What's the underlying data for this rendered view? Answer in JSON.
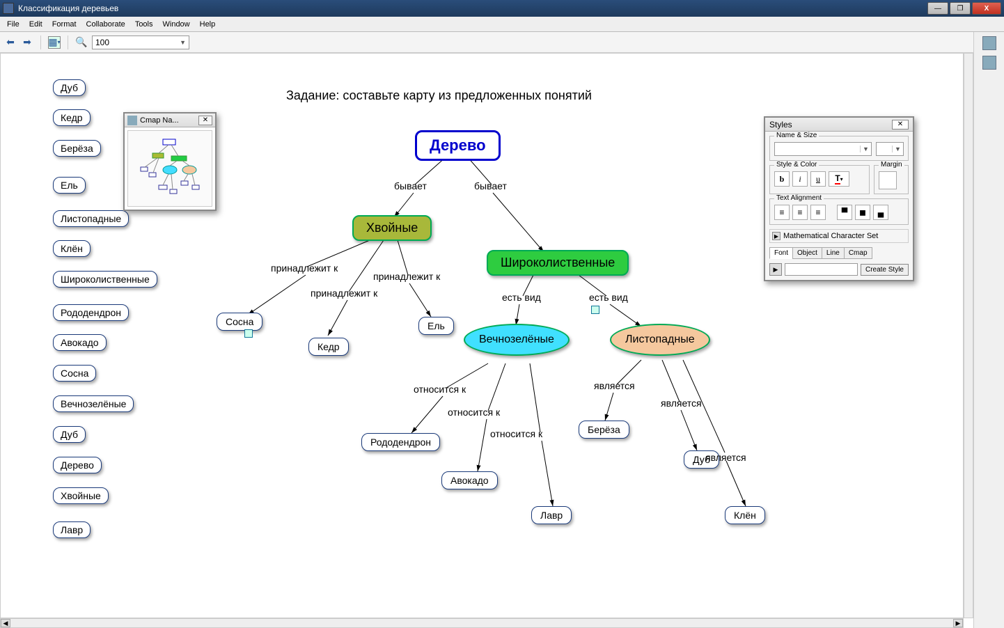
{
  "window": {
    "title": "Классификация деревьев"
  },
  "menu": {
    "file": "File",
    "edit": "Edit",
    "format": "Format",
    "collaborate": "Collaborate",
    "tools": "Tools",
    "window": "Window",
    "help": "Help"
  },
  "toolbar": {
    "zoom": "100"
  },
  "task": "Задание: составьте карту из предложенных понятий",
  "palette": [
    "Дуб",
    "Кедр",
    "Берёза",
    "Ель",
    "Листопадные",
    "Клён",
    "Широколиственные",
    "Рододендрон",
    "Авокадо",
    "Сосна",
    "Вечнозелёные",
    "Дуб",
    "Дерево",
    "Хвойные",
    "Лавр"
  ],
  "nodes": {
    "root": "Дерево",
    "conifer": "Хвойные",
    "broadleaf": "Широколиственные",
    "pine": "Сосна",
    "cedar": "Кедр",
    "spruce": "Ель",
    "evergreen": "Вечнозелёные",
    "deciduous": "Листопадные",
    "rhodo": "Рододендрон",
    "avocado": "Авокадо",
    "laurel": "Лавр",
    "birch": "Берёза",
    "oak": "Дуб",
    "maple": "Клён"
  },
  "links": {
    "byvaet1": "бывает",
    "byvaet2": "бывает",
    "belongs1": "принадлежит к",
    "belongs2": "принадлежит к",
    "belongs3": "принадлежит к",
    "hasType1": "есть вид",
    "hasType2": "есть вид",
    "relates1": "относится к",
    "relates2": "относится к",
    "relates3": "относится к",
    "is1": "является",
    "is2": "является",
    "is3": "является"
  },
  "nav": {
    "title": "Cmap Na..."
  },
  "styles": {
    "title": "Styles",
    "nameSize": "Name & Size",
    "styleColor": "Style & Color",
    "margin": "Margin",
    "textAlign": "Text Alignment",
    "mathSet": "Mathematical Character Set",
    "tabs": {
      "font": "Font",
      "object": "Object",
      "line": "Line",
      "cmap": "Cmap"
    },
    "createStyle": "Create Style"
  }
}
